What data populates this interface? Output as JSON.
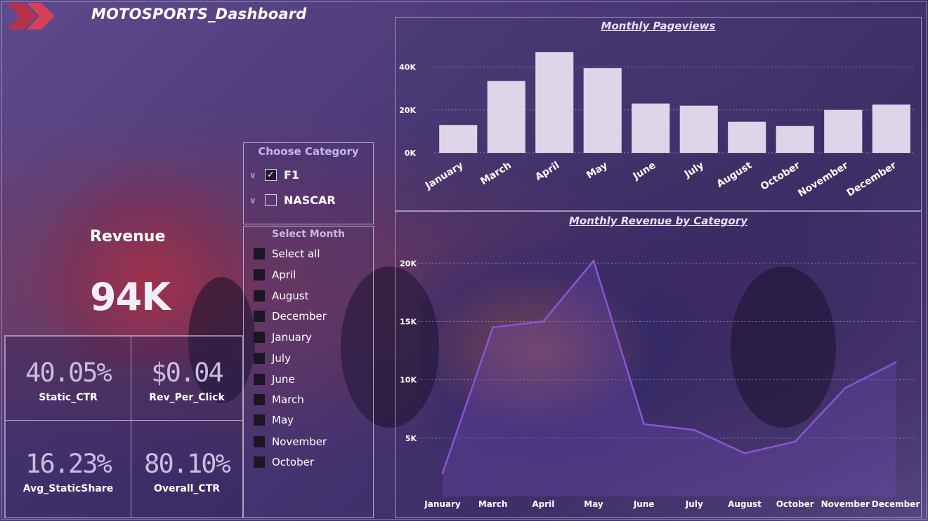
{
  "app": {
    "title": "MOTOSPORTS_Dashboard"
  },
  "revenue": {
    "label": "Revenue",
    "value": "94K"
  },
  "kpis": [
    {
      "value": "40.05%",
      "label": "Static_CTR"
    },
    {
      "value": "$0.04",
      "label": "Rev_Per_Click"
    },
    {
      "value": "16.23%",
      "label": "Avg_StaticShare"
    },
    {
      "value": "80.10%",
      "label": "Overall_CTR"
    }
  ],
  "category_slicer": {
    "title": "Choose Category",
    "items": [
      {
        "label": "F1",
        "checked": true
      },
      {
        "label": "NASCAR",
        "checked": false
      }
    ]
  },
  "month_slicer": {
    "title": "Select Month",
    "items": [
      "Select all",
      "April",
      "August",
      "December",
      "January",
      "July",
      "June",
      "March",
      "May",
      "November",
      "October"
    ]
  },
  "colors": {
    "bar": "#dcd6e8",
    "line": "#8a55d6",
    "area": "#7a4fc0"
  },
  "chart_data": [
    {
      "type": "bar",
      "title": "Monthly Pageviews",
      "categories": [
        "January",
        "March",
        "April",
        "May",
        "June",
        "July",
        "August",
        "October",
        "November",
        "December"
      ],
      "values": [
        13000,
        33500,
        47000,
        39500,
        23000,
        22000,
        14500,
        12500,
        20000,
        22500
      ],
      "yticks": [
        "0K",
        "20K",
        "40K"
      ],
      "ylim": [
        0,
        50000
      ],
      "grid": true
    },
    {
      "type": "area",
      "title": "Monthly Revenue by Category",
      "categories": [
        "January",
        "March",
        "April",
        "May",
        "June",
        "July",
        "August",
        "October",
        "November",
        "December"
      ],
      "values": [
        2000,
        14500,
        15000,
        20200,
        6200,
        5700,
        3700,
        4700,
        9300,
        11500
      ],
      "yticks": [
        "5K",
        "10K",
        "15K",
        "20K"
      ],
      "ylim": [
        0,
        22000
      ],
      "grid": true
    }
  ]
}
